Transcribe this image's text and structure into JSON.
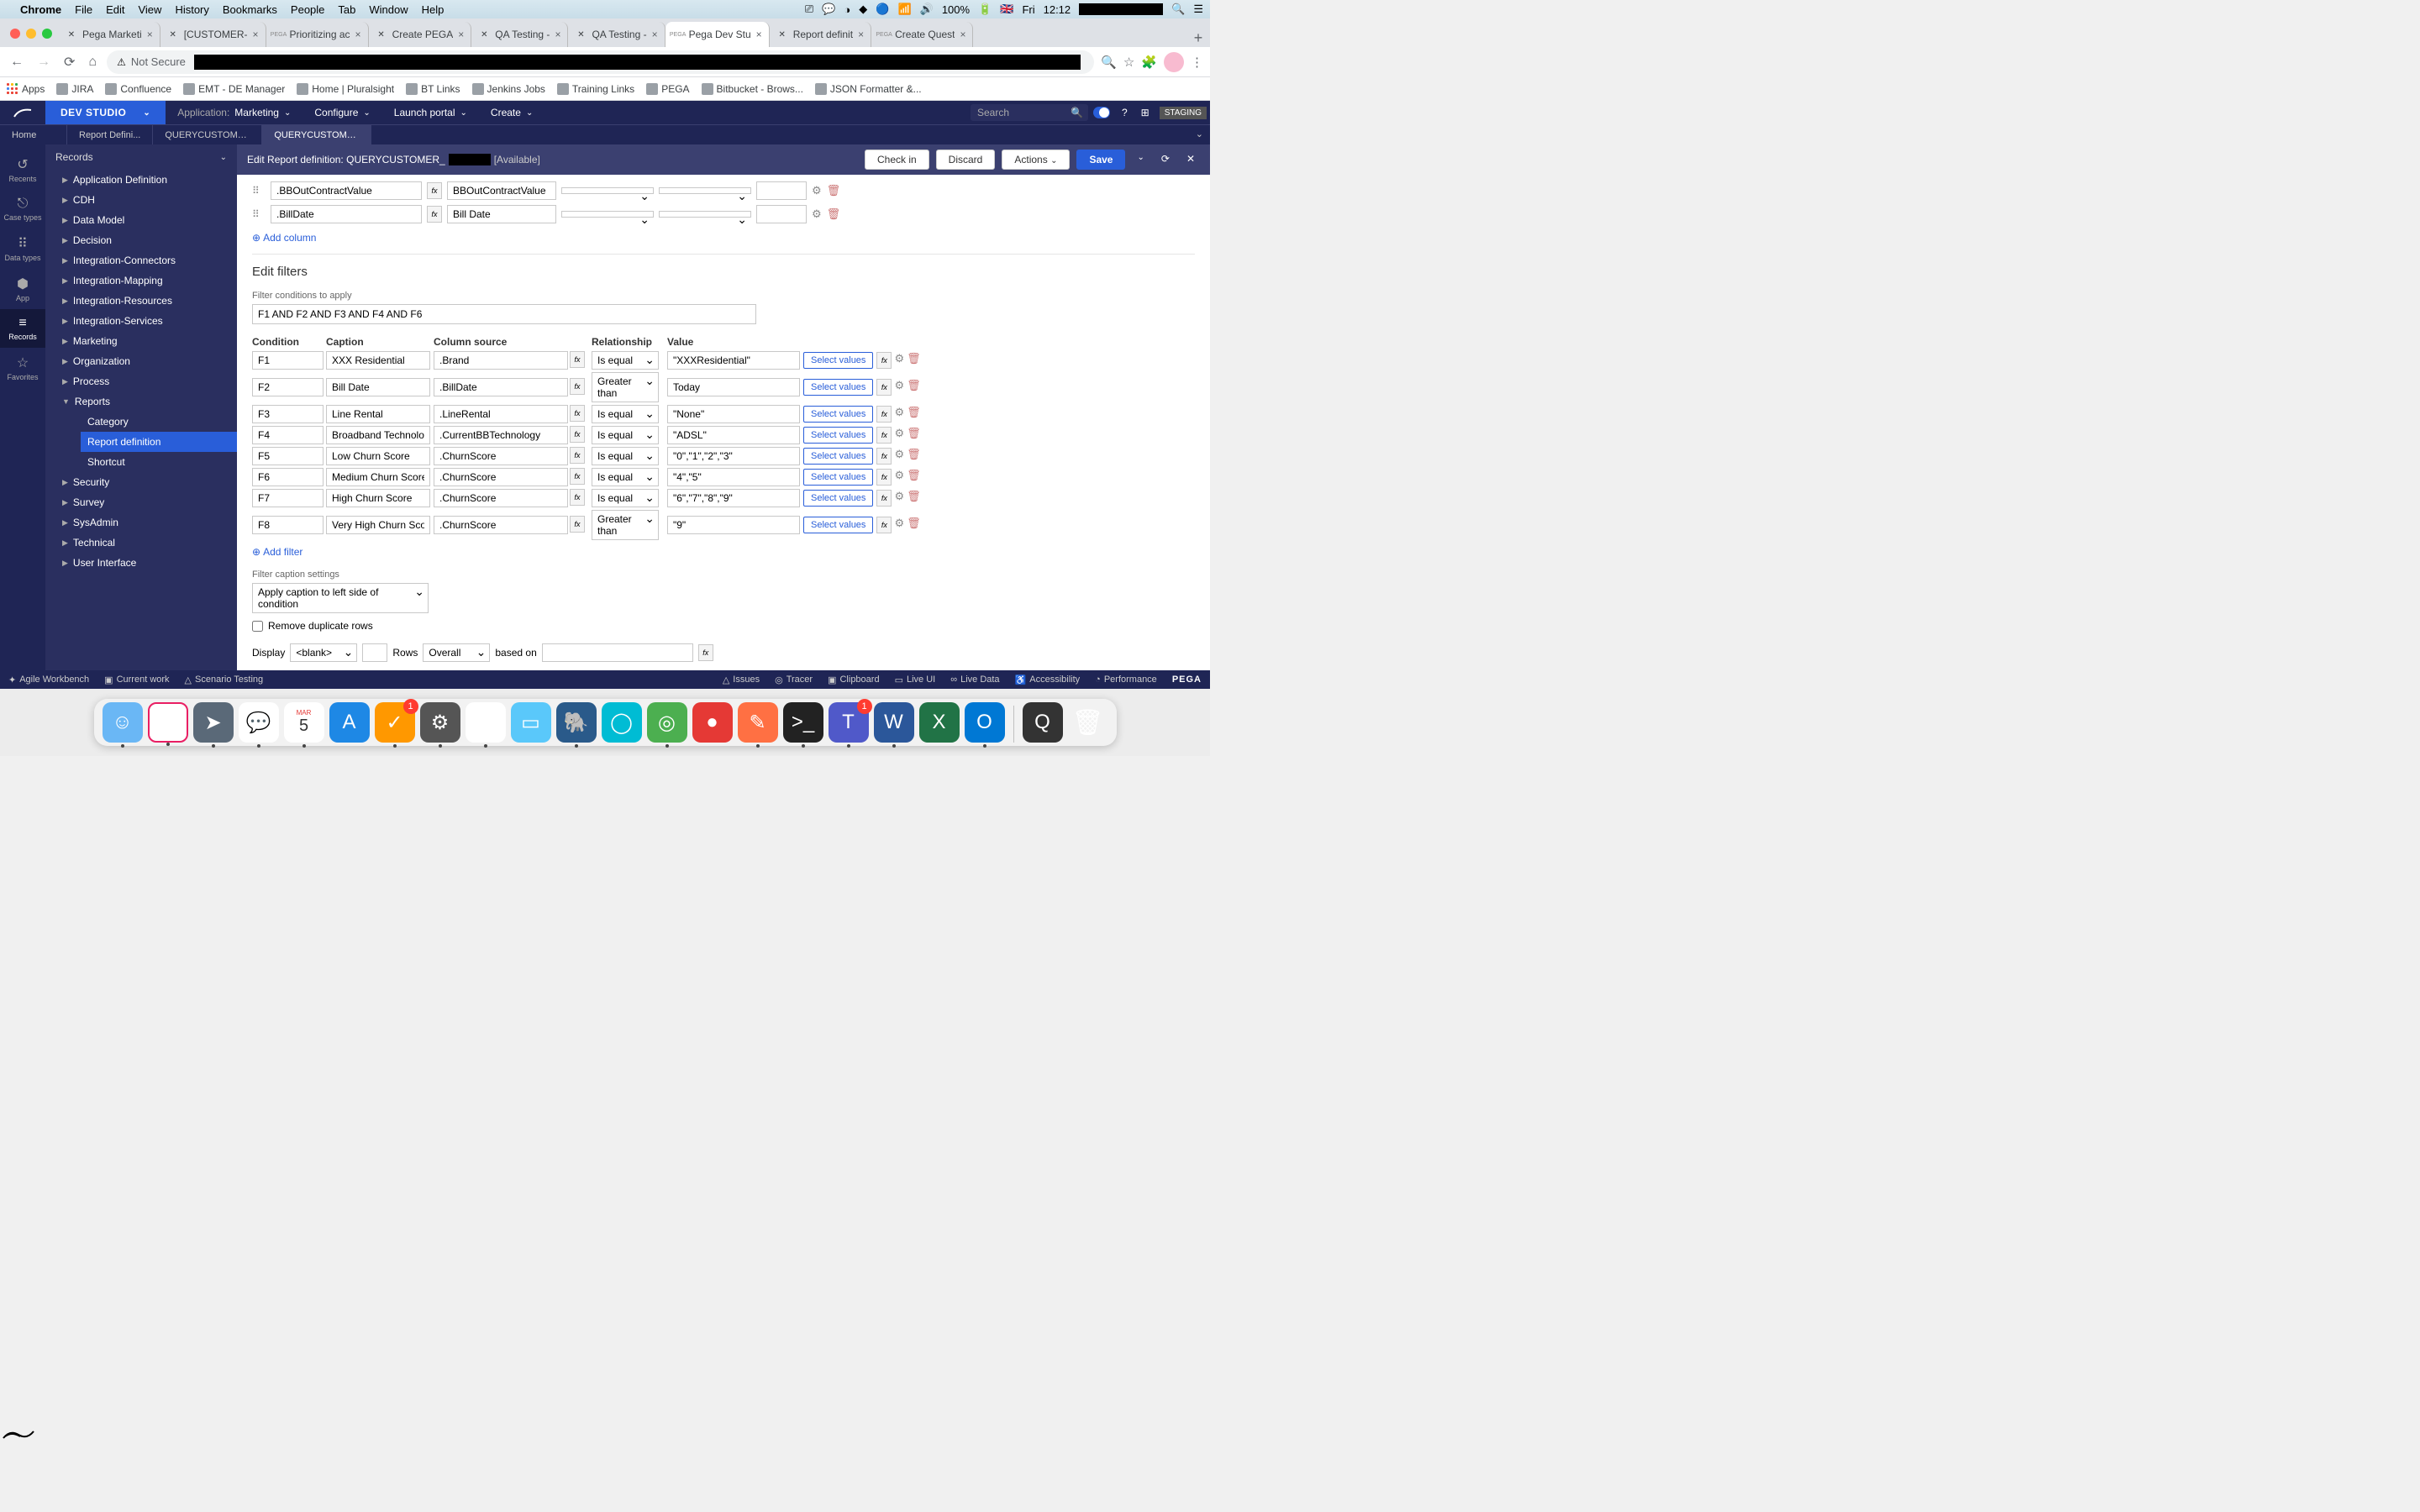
{
  "macos": {
    "app": "Chrome",
    "menus": [
      "File",
      "Edit",
      "View",
      "History",
      "Bookmarks",
      "People",
      "Tab",
      "Window",
      "Help"
    ],
    "battery": "100%",
    "day": "Fri",
    "time": "12:12"
  },
  "chrome": {
    "tabs": [
      {
        "title": "Pega Marketi",
        "active": false
      },
      {
        "title": "[CUSTOMER-",
        "active": false
      },
      {
        "title": "Prioritizing ac",
        "active": false,
        "prefix": "PEGA"
      },
      {
        "title": "Create PEGA",
        "active": false
      },
      {
        "title": "QA Testing -",
        "active": false
      },
      {
        "title": "QA Testing -",
        "active": false
      },
      {
        "title": "Pega Dev Stu",
        "active": true,
        "prefix": "PEGA"
      },
      {
        "title": "Report definit",
        "active": false
      },
      {
        "title": "Create Quest",
        "active": false,
        "prefix": "PEGA"
      }
    ],
    "not_secure": "Not Secure",
    "bookmarks": [
      {
        "label": "Apps",
        "icon": "grid"
      },
      {
        "label": "JIRA"
      },
      {
        "label": "Confluence"
      },
      {
        "label": "EMT - DE Manager"
      },
      {
        "label": "Home | Pluralsight"
      },
      {
        "label": "BT Links"
      },
      {
        "label": "Jenkins Jobs"
      },
      {
        "label": "Training Links"
      },
      {
        "label": "PEGA"
      },
      {
        "label": "Bitbucket - Brows..."
      },
      {
        "label": "JSON Formatter &..."
      }
    ]
  },
  "pega": {
    "studio": "DEV STUDIO",
    "app_label": "Application:",
    "app_value": "Marketing",
    "menus": [
      "Configure",
      "Launch portal",
      "Create"
    ],
    "search_placeholder": "Search",
    "staging": "STAGING",
    "content_tabs": [
      {
        "title": "Home"
      },
      {
        "title": "Report Defini..."
      },
      {
        "title": "QUERYCUSTOMER..."
      },
      {
        "title": "QUERYCUSTOMER...",
        "active": true
      }
    ],
    "edit_label": "Edit",
    "edit_type": "Report definition:",
    "edit_name": "QUERYCUSTOMER_",
    "edit_status": "[Available]",
    "buttons": {
      "checkin": "Check in",
      "discard": "Discard",
      "actions": "Actions",
      "save": "Save"
    }
  },
  "rail": [
    {
      "icon": "↺",
      "label": "Recents"
    },
    {
      "icon": "⎋",
      "label": "Case types"
    },
    {
      "icon": "⠿",
      "label": "Data types"
    },
    {
      "icon": "⬢",
      "label": "App"
    },
    {
      "icon": "≡",
      "label": "Records",
      "active": true
    },
    {
      "icon": "☆",
      "label": "Favorites"
    }
  ],
  "sidebar": {
    "header": "Records",
    "items": [
      {
        "label": "Application Definition"
      },
      {
        "label": "CDH"
      },
      {
        "label": "Data Model"
      },
      {
        "label": "Decision"
      },
      {
        "label": "Integration-Connectors"
      },
      {
        "label": "Integration-Mapping"
      },
      {
        "label": "Integration-Resources"
      },
      {
        "label": "Integration-Services"
      },
      {
        "label": "Marketing"
      },
      {
        "label": "Organization"
      },
      {
        "label": "Process"
      },
      {
        "label": "Reports",
        "expanded": true,
        "children": [
          {
            "label": "Category"
          },
          {
            "label": "Report definition",
            "active": true
          },
          {
            "label": "Shortcut"
          }
        ]
      },
      {
        "label": "Security"
      },
      {
        "label": "Survey"
      },
      {
        "label": "SysAdmin"
      },
      {
        "label": "Technical"
      },
      {
        "label": "User Interface"
      }
    ]
  },
  "columns": [
    {
      "source": ".BBOutContractValue",
      "label": "BBOutContractValue",
      "sort": "<blank>",
      "sort2": "<blank>"
    },
    {
      "source": ".BillDate",
      "label": "Bill Date",
      "sort": "<blank>",
      "sort2": "<blank>"
    }
  ],
  "add_column": "Add column",
  "filters": {
    "title": "Edit filters",
    "cond_label": "Filter conditions to apply",
    "cond_value": "F1 AND F2 AND F3 AND F4 AND F6",
    "headers": {
      "cond": "Condition",
      "cap": "Caption",
      "src": "Column source",
      "rel": "Relationship",
      "val": "Value"
    },
    "rows": [
      {
        "c": "F1",
        "cap": "XXX Residential",
        "src": ".Brand",
        "rel": "Is equal",
        "val": "\"XXXResidential\""
      },
      {
        "c": "F2",
        "cap": "Bill Date",
        "src": ".BillDate",
        "rel": "Greater than",
        "val": "Today"
      },
      {
        "c": "F3",
        "cap": "Line Rental",
        "src": ".LineRental",
        "rel": "Is equal",
        "val": "\"None\""
      },
      {
        "c": "F4",
        "cap": "Broadband Technology",
        "src": ".CurrentBBTechnology",
        "rel": "Is equal",
        "val": "\"ADSL\""
      },
      {
        "c": "F5",
        "cap": "Low Churn Score",
        "src": ".ChurnScore",
        "rel": "Is equal",
        "val": "\"0\",\"1\",\"2\",\"3\""
      },
      {
        "c": "F6",
        "cap": "Medium Churn Score",
        "src": ".ChurnScore",
        "rel": "Is equal",
        "val": "\"4\",\"5\""
      },
      {
        "c": "F7",
        "cap": "High Churn Score",
        "src": ".ChurnScore",
        "rel": "Is equal",
        "val": "\"6\",\"7\",\"8\",\"9\""
      },
      {
        "c": "F8",
        "cap": "Very High Churn Score",
        "src": ".ChurnScore",
        "rel": "Greater than",
        "val": "\"9\""
      }
    ],
    "select_values": "Select values",
    "add_filter": "Add filter",
    "caption_settings_label": "Filter caption settings",
    "caption_settings_value": "Apply caption to left side of condition",
    "remove_dup": "Remove duplicate rows",
    "display": "Display",
    "display_val": "<blank>",
    "rows_label": "Rows",
    "rows_val": "Overall",
    "based_on": "based on"
  },
  "bottom": {
    "left": [
      {
        "icon": "✦",
        "label": "Agile Workbench"
      },
      {
        "icon": "▣",
        "label": "Current work"
      },
      {
        "icon": "△",
        "label": "Scenario Testing"
      }
    ],
    "right": [
      {
        "icon": "△",
        "label": "Issues"
      },
      {
        "icon": "◎",
        "label": "Tracer"
      },
      {
        "icon": "▣",
        "label": "Clipboard"
      },
      {
        "icon": "▭",
        "label": "Live UI"
      },
      {
        "icon": "∞",
        "label": "Live Data"
      },
      {
        "icon": "♿",
        "label": "Accessibility"
      },
      {
        "icon": "◔",
        "label": "Performance"
      }
    ],
    "logo": "PEGA"
  },
  "dock": [
    {
      "bg": "#6ab7f5",
      "glyph": "☺",
      "dot": true
    },
    {
      "bg": "#fff",
      "glyph": "✚",
      "dot": true,
      "border": "#e91e63"
    },
    {
      "bg": "#5a6978",
      "glyph": "➤",
      "dot": true
    },
    {
      "bg": "#fff",
      "glyph": "💬",
      "dot": true,
      "color": "#e91e63"
    },
    {
      "bg": "#fff",
      "glyph": "5",
      "dot": true,
      "sub": "MAR",
      "color": "#333"
    },
    {
      "bg": "#1e88e5",
      "glyph": "A",
      "dot": false
    },
    {
      "bg": "#ff9800",
      "glyph": "✓",
      "dot": true,
      "badge": "1"
    },
    {
      "bg": "#555",
      "glyph": "⚙",
      "dot": true
    },
    {
      "bg": "#fff",
      "glyph": "◉",
      "dot": true
    },
    {
      "bg": "#5ac8fa",
      "glyph": "▭",
      "dot": false
    },
    {
      "bg": "#2a5a8a",
      "glyph": "🐘",
      "dot": true
    },
    {
      "bg": "#00bcd4",
      "glyph": "◯",
      "dot": false
    },
    {
      "bg": "#4caf50",
      "glyph": "◎",
      "dot": true
    },
    {
      "bg": "#e53935",
      "glyph": "●",
      "dot": false
    },
    {
      "bg": "#ff7043",
      "glyph": "✎",
      "dot": true
    },
    {
      "bg": "#222",
      "glyph": ">_",
      "dot": true
    },
    {
      "bg": "#5059c9",
      "glyph": "T",
      "dot": true,
      "badge": "1"
    },
    {
      "bg": "#2b579a",
      "glyph": "W",
      "dot": true
    },
    {
      "bg": "#217346",
      "glyph": "X",
      "dot": false
    },
    {
      "bg": "#0078d4",
      "glyph": "O",
      "dot": true
    },
    {
      "bg": "#333",
      "glyph": "Q",
      "dot": false,
      "sep_before": true
    },
    {
      "bg": "#e8e8e8",
      "glyph": "",
      "dot": false,
      "trash": true
    }
  ]
}
